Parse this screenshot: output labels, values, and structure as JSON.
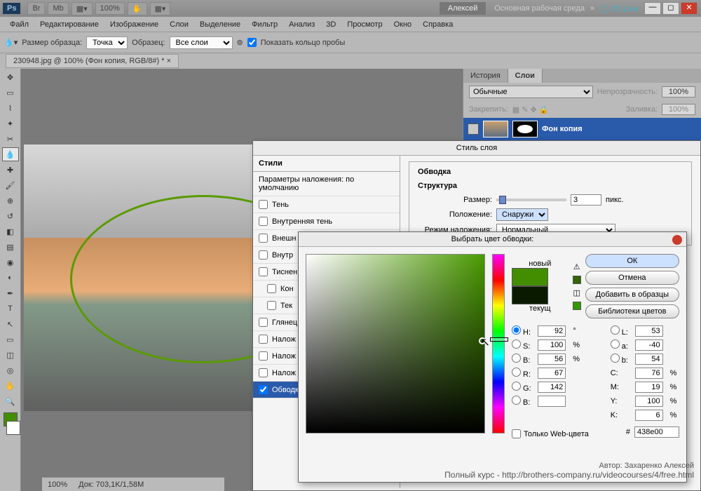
{
  "app": {
    "logo": "Ps",
    "zoom": "100%",
    "user": "Алексей",
    "workspace": "Основная рабочая среда",
    "cslive": "CS Live"
  },
  "menus": [
    "Файл",
    "Редактирование",
    "Изображение",
    "Слои",
    "Выделение",
    "Фильтр",
    "Анализ",
    "3D",
    "Просмотр",
    "Окно",
    "Справка"
  ],
  "options": {
    "sampleSizeLabel": "Размер образца:",
    "sampleSizeValue": "Точка",
    "sampleLabel": "Образец:",
    "sampleValue": "Все слои",
    "showRingLabel": "Показать кольцо пробы"
  },
  "document": {
    "tab": "230948.jpg @ 100% (Фон копия, RGB/8#) *"
  },
  "panels": {
    "historyTab": "История",
    "layersTab": "Слои",
    "blendMode": "Обычные",
    "opacityLabel": "Непрозрачность:",
    "opacityValue": "100%",
    "lockLabel": "Закрепить:",
    "fillLabel": "Заливка:",
    "fillValue": "100%",
    "layerName": "Фон копия"
  },
  "layerStyle": {
    "title": "Стиль слоя",
    "stylesHeader": "Стили",
    "defaultParams": "Параметры наложения: по умолчанию",
    "effects": [
      "Тень",
      "Внутренняя тень",
      "Внешн",
      "Внутр",
      "Тиснен",
      "Кон",
      "Тек",
      "Глянец",
      "Налож",
      "Налож",
      "Налож",
      "Обводк"
    ],
    "effectChecked": [
      false,
      false,
      false,
      false,
      false,
      false,
      false,
      false,
      false,
      false,
      false,
      true
    ],
    "strokeHeader": "Обводка",
    "structureHeader": "Структура",
    "sizeLabel": "Размер:",
    "sizeValue": "3",
    "sizeUnit": "пикс.",
    "positionLabel": "Положение:",
    "positionValue": "Снаружи",
    "blendModeLabel": "Режим наложения:",
    "blendModeValue": "Нормальный"
  },
  "colorPicker": {
    "title": "Выбрать цвет обводки:",
    "newLabel": "новый",
    "currentLabel": "текущ",
    "colorNew": "#438e00",
    "colorCurrent": "#0a1a00",
    "ok": "ОК",
    "cancel": "Отмена",
    "addSwatch": "Добавить в образцы",
    "libraries": "Библиотеки цветов",
    "H": "92",
    "S": "100",
    "B": "56",
    "R": "67",
    "G": "142",
    "Bv": "",
    "L": "53",
    "a": "-40",
    "b": "54",
    "C": "76",
    "M": "19",
    "Y": "100",
    "K": "6",
    "hex": "438e00",
    "webOnly": "Только Web-цвета"
  },
  "status": {
    "zoom": "100%",
    "doc": "Док: 703,1K/1,58M"
  },
  "watermark": {
    "author": "Автор: Захаренко Алексей",
    "url": "Полный курс - http://brothers-company.ru/videocourses/4/free.html"
  }
}
